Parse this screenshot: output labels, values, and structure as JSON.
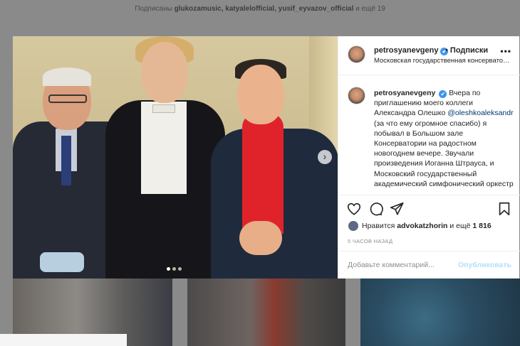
{
  "background": {
    "followers_prefix": "Подписаны",
    "followers_names": "glukozamusic, katyalelofficial, yusif_eyvazov_official",
    "followers_suffix": "и ещё 19"
  },
  "post": {
    "username": "petrosyanevgeny",
    "verified_mark": "✔",
    "follow_label": "• Подписки",
    "location": "Московская государственная консерватория",
    "more_label": "•••",
    "carousel": {
      "next_label": "›",
      "slides": 3,
      "active_slide": 1
    }
  },
  "caption": {
    "user": "petrosyanevgeny",
    "text_before": "Вчера по приглашению моего коллеги Александра Олешко",
    "mention": "@oleshkoaleksandr",
    "text_after": "(за что ему огромное спасибо) я побывал в Большом зале Консерватории на радостном новогоднем вечере. Звучали произведения Иоганна Штрауса, и Московский государственный академический симфонический оркестр"
  },
  "actions": {
    "icons": [
      "heart-icon",
      "comment-icon",
      "share-icon",
      "bookmark-icon"
    ],
    "likes_prefix": "Нравится",
    "likes_user": "advokatzhorin",
    "likes_suffix": "и ещё",
    "likes_count": "1 816",
    "time": "5 ЧАСОВ НАЗАД"
  },
  "comment": {
    "placeholder": "Добавьте комментарий...",
    "publish_label": "Опубликовать"
  }
}
